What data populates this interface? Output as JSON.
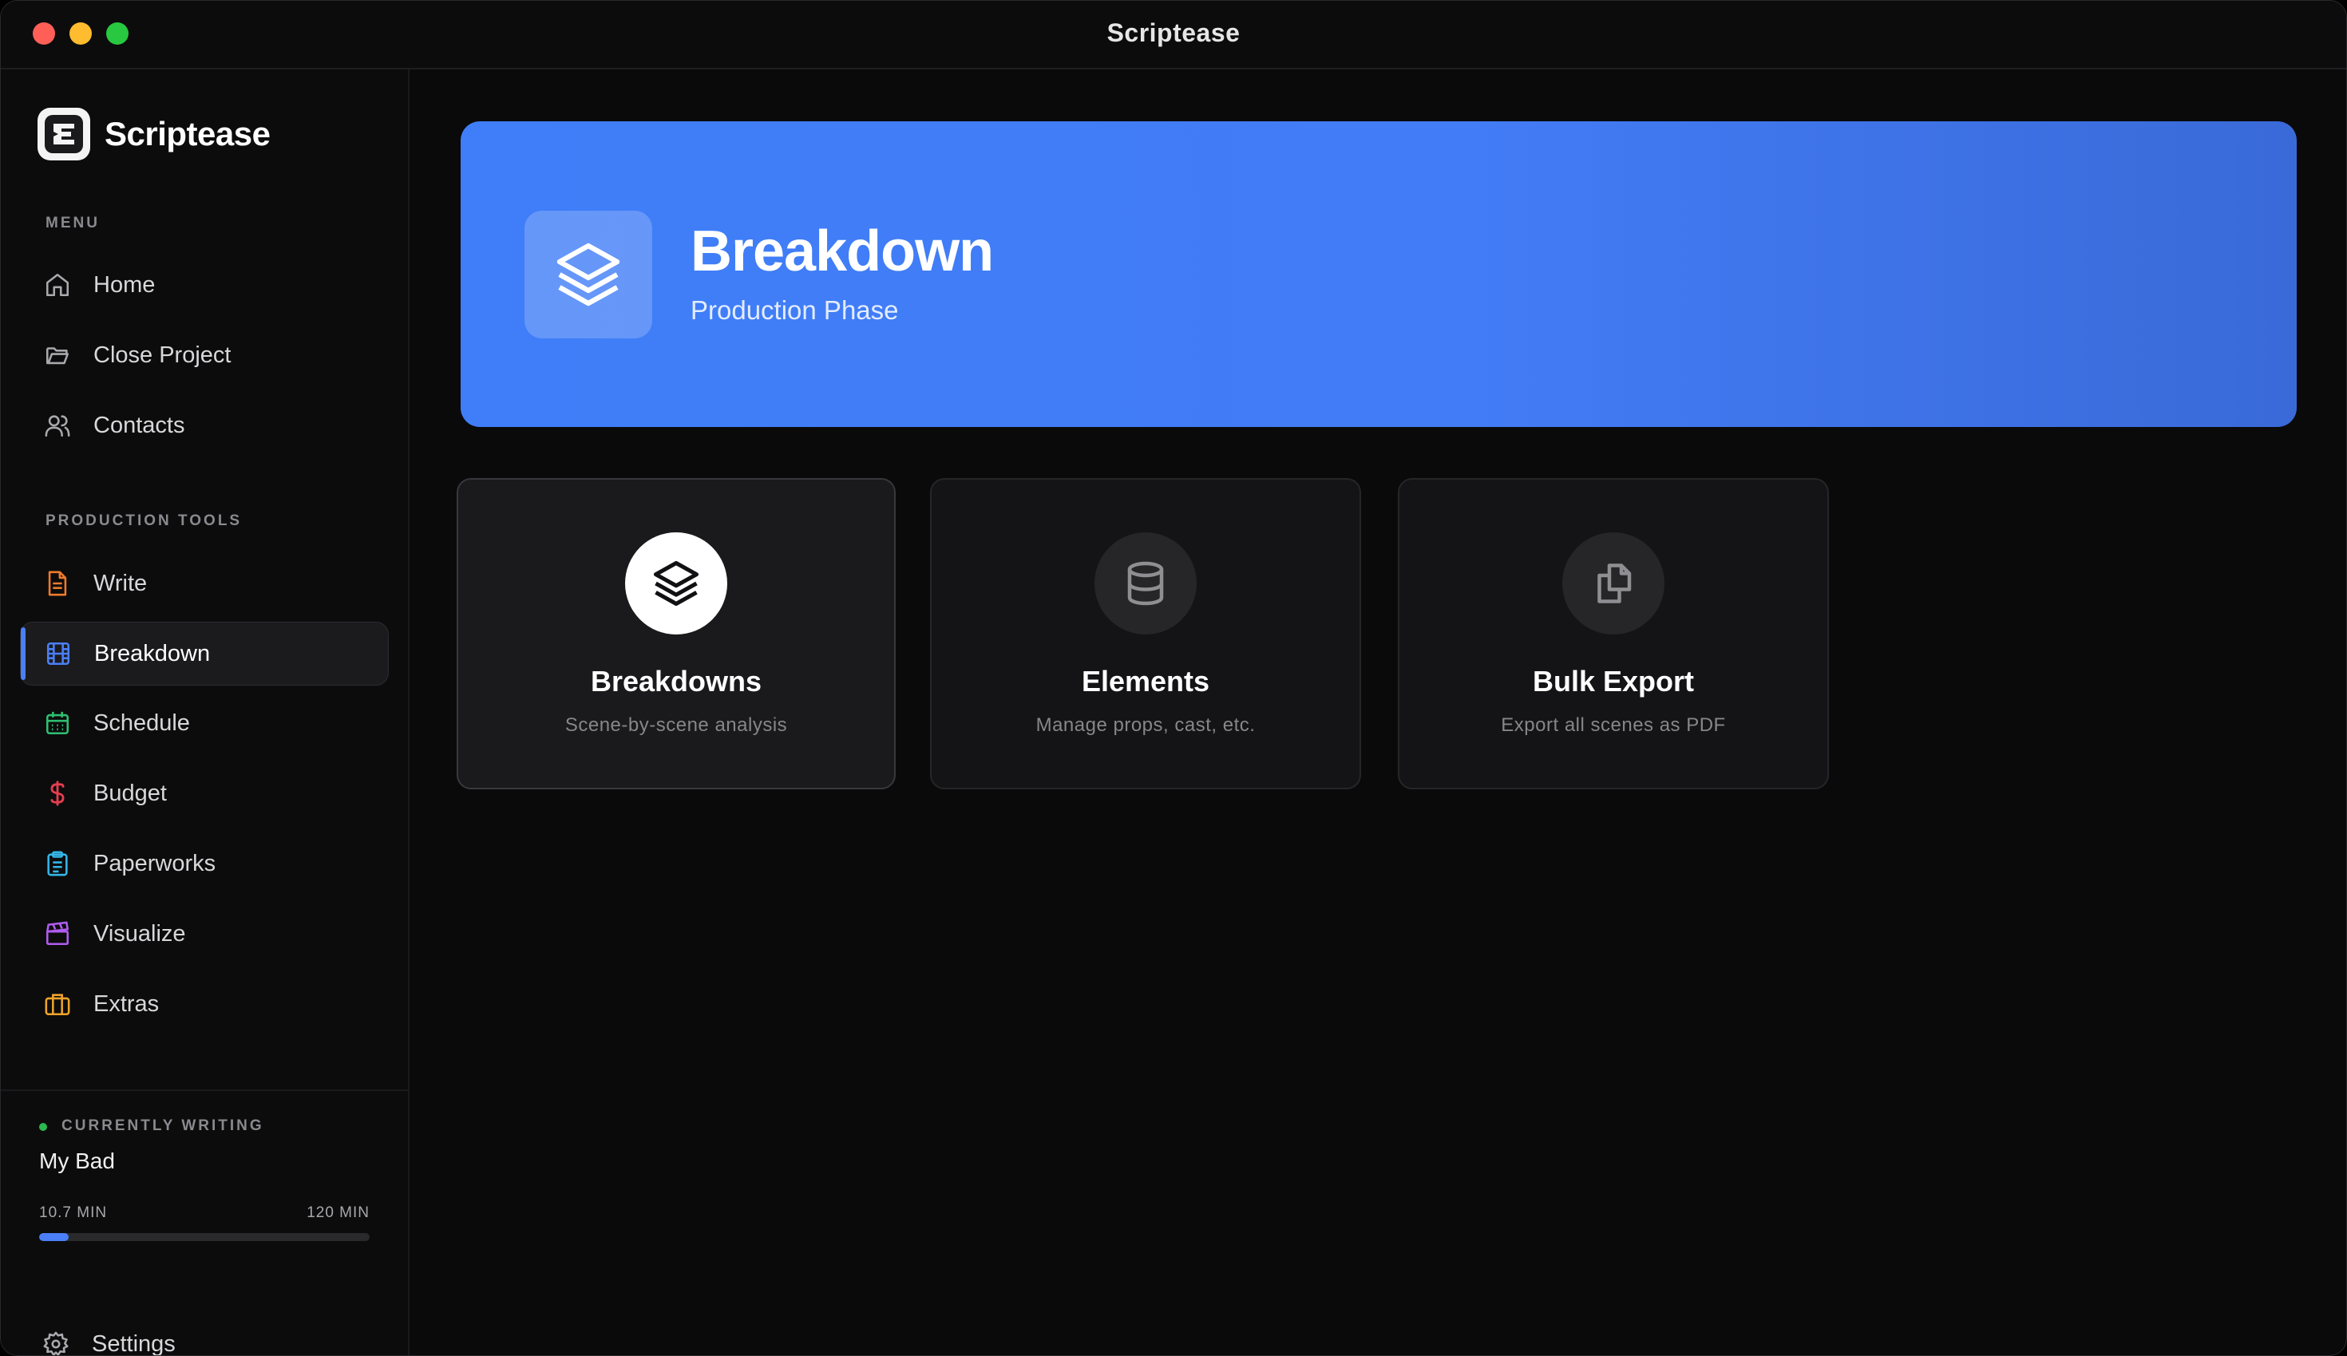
{
  "window": {
    "title": "Scriptease"
  },
  "brand": {
    "name": "Scriptease"
  },
  "sidebar": {
    "menu_label": "MENU",
    "menu_items": [
      {
        "label": "Home",
        "icon": "home-icon"
      },
      {
        "label": "Close Project",
        "icon": "folder-open-icon"
      },
      {
        "label": "Contacts",
        "icon": "users-icon"
      }
    ],
    "tools_label": "PRODUCTION TOOLS",
    "tool_items": [
      {
        "label": "Write",
        "icon": "document-icon",
        "color": "#f07a2a"
      },
      {
        "label": "Breakdown",
        "icon": "film-icon",
        "color": "#4a7ff7",
        "active": true
      },
      {
        "label": "Schedule",
        "icon": "calendar-icon",
        "color": "#2fbf71"
      },
      {
        "label": "Budget",
        "icon": "dollar-icon",
        "color": "#e53e4f"
      },
      {
        "label": "Paperworks",
        "icon": "clipboard-icon",
        "color": "#35b6e8"
      },
      {
        "label": "Visualize",
        "icon": "clapperboard-icon",
        "color": "#b05cf0"
      },
      {
        "label": "Extras",
        "icon": "briefcase-icon",
        "color": "#f0a42a"
      }
    ],
    "currently_writing": {
      "label": "CURRENTLY WRITING",
      "title": "My Bad",
      "current": "10.7 MIN",
      "target": "120 MIN",
      "progress_fraction": 0.089
    },
    "settings_label": "Settings"
  },
  "hero": {
    "title": "Breakdown",
    "subtitle": "Production Phase",
    "icon": "layers-icon",
    "color": "#427cf6"
  },
  "cards": [
    {
      "title": "Breakdowns",
      "description": "Scene-by-scene analysis",
      "icon": "layers-icon",
      "selected": true
    },
    {
      "title": "Elements",
      "description": "Manage props, cast, etc.",
      "icon": "database-icon"
    },
    {
      "title": "Bulk Export",
      "description": "Export all scenes as PDF",
      "icon": "copy-icon"
    }
  ]
}
